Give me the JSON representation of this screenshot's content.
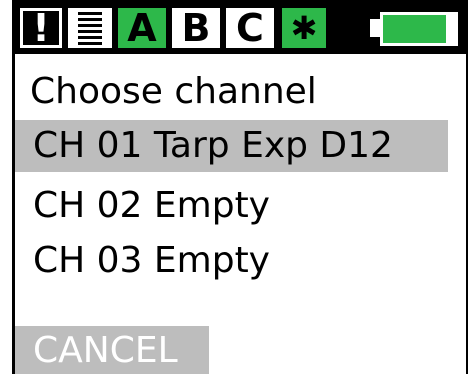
{
  "colors": {
    "status_bar": "#000000",
    "accent_green": "#2db84a",
    "selected_row": "#bdbdbd",
    "cancel_bg": "#bdbdbd"
  },
  "status_bar": {
    "alert_label": "!",
    "lines_icon": "signal-lines-icon",
    "channel_a_label": "A",
    "channel_b_label": "B",
    "channel_c_label": "C",
    "bluetooth_icon": "bluetooth-icon",
    "bluetooth_glyph": "✱",
    "battery_level": 0.88
  },
  "menu": {
    "title": "Choose channel",
    "channels": [
      {
        "label": "CH 01 Tarp Exp D12",
        "selected": true
      },
      {
        "label": "CH 02 Empty",
        "selected": false
      },
      {
        "label": "CH 03 Empty",
        "selected": false
      }
    ],
    "cancel_label": "CANCEL"
  }
}
